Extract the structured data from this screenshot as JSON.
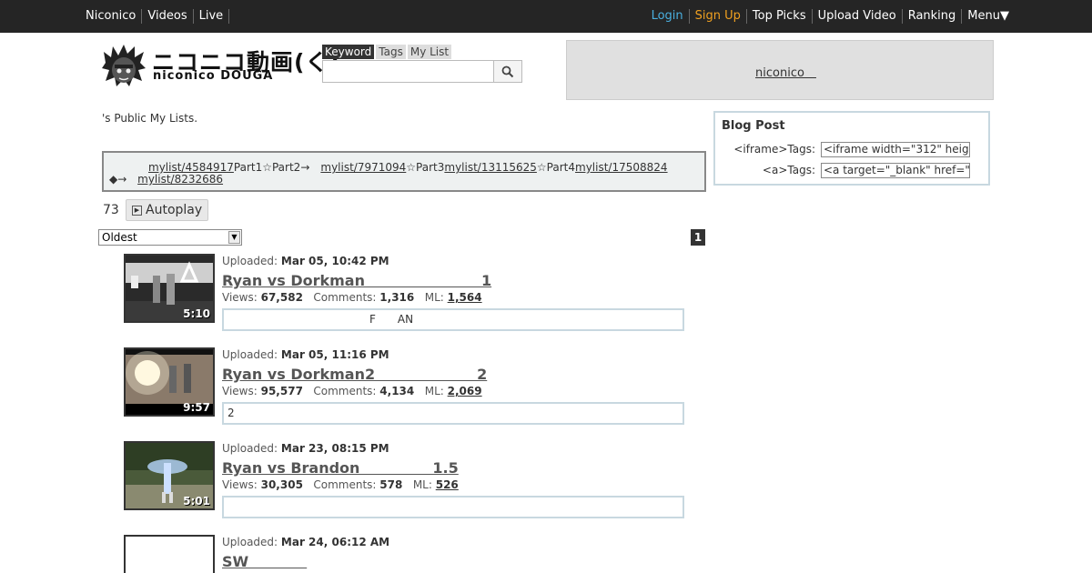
{
  "topbar": {
    "left": [
      "Niconico",
      "Videos",
      "Live"
    ],
    "right": {
      "login": "Login",
      "signup": "Sign Up",
      "top_picks": "Top Picks",
      "upload": "Upload Video",
      "ranking": "Ranking",
      "menu": "Menu▼"
    },
    "colors": {
      "bar": "#252525",
      "login": "#4ab0e0",
      "signup": "#f0a020"
    }
  },
  "logo": {
    "jp": "ニコニコ動画(く)",
    "en": "niconico DOUGA"
  },
  "search": {
    "tabs": [
      "Keyword",
      "Tags",
      "My List"
    ],
    "active_tab": "Keyword",
    "value": "",
    "button_icon": "search-icon"
  },
  "ad": {
    "link": "niconico　"
  },
  "owner_text": "'s Public My Lists.",
  "description": {
    "line1": [
      {
        "type": "link",
        "text": "mylist/4584917"
      },
      {
        "type": "text",
        "text": "Part1☆Part2→　"
      },
      {
        "type": "link",
        "text": "mylist/7971094"
      },
      {
        "type": "text",
        "text": "☆Part3"
      },
      {
        "type": "link",
        "text": "mylist/13115625"
      },
      {
        "type": "text",
        "text": "☆Part4"
      },
      {
        "type": "link",
        "text": "mylist/17508824"
      }
    ],
    "line2_prefix": "◆→",
    "line2_link": "mylist/8232686"
  },
  "count": "73",
  "autoplay_label": "Autoplay",
  "sort": {
    "selected": "Oldest"
  },
  "page": "1",
  "videos": [
    {
      "uploaded_label": "Uploaded:",
      "uploaded": "Mar 05, 10:42 PM",
      "title": "Ryan vs Dorkman　　　　　　　　1",
      "views_label": "Views:",
      "views": "67,582",
      "comments_label": "Comments:",
      "comments": "1,316",
      "ml_label": "ML:",
      "ml": "1,564",
      "duration": "5:10",
      "description": "　　　　　　　　　　　　　F　　AN"
    },
    {
      "uploaded_label": "Uploaded:",
      "uploaded": "Mar 05, 11:16 PM",
      "title": "Ryan vs Dorkman2　　　　　　　2",
      "views_label": "Views:",
      "views": "95,577",
      "comments_label": "Comments:",
      "comments": "4,134",
      "ml_label": "ML:",
      "ml": "2,069",
      "duration": "9:57",
      "description": "2"
    },
    {
      "uploaded_label": "Uploaded:",
      "uploaded": "Mar 23, 08:15 PM",
      "title": "Ryan vs Brandon　　　　　1.5",
      "views_label": "Views:",
      "views": "30,305",
      "comments_label": "Comments:",
      "comments": "578",
      "ml_label": "ML:",
      "ml": "526",
      "duration": "5:01",
      "description": ""
    },
    {
      "uploaded_label": "Uploaded:",
      "uploaded": "Mar 24, 06:12 AM",
      "title": "SW　　　　"
    }
  ],
  "blog": {
    "title": "Blog Post",
    "iframe_label": "<iframe>Tags:",
    "iframe_value": "<iframe width=\"312\" heig",
    "a_label": "<a>Tags:",
    "a_value": "<a target=\"_blank\" href=\""
  }
}
